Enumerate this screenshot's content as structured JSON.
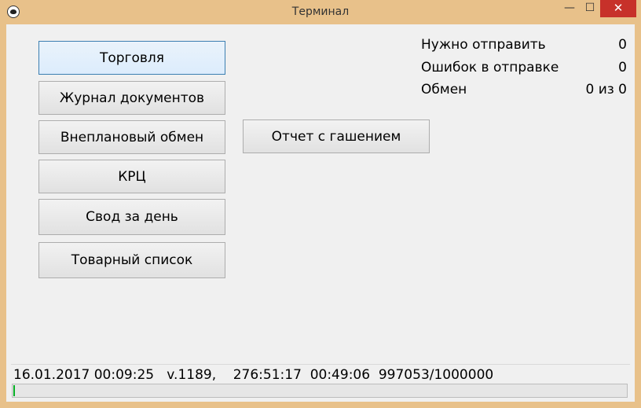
{
  "window": {
    "title": "Терминал",
    "minimize_glyph": "—",
    "maximize_glyph": "☐",
    "close_glyph": "✕",
    "close_color": "#c7312a",
    "frame_color": "#e8c18a"
  },
  "menu": {
    "trade": "Торговля",
    "journal": "Журнал документов",
    "unplanned_exchange": "Внеплановый обмен",
    "krc": "КРЦ",
    "day_summary": "Свод за день",
    "goods_list": "Товарный список",
    "z_report": "Отчет с гашением"
  },
  "stats": {
    "to_send_label": "Нужно отправить",
    "to_send_value": "0",
    "send_errors_label": "Ошибок в отправке",
    "send_errors_value": "0",
    "exchange_label": "Обмен",
    "exchange_value": "0 из 0"
  },
  "status": {
    "text": "16.01.2017 00:09:25   v.1189,    276:51:17  00:49:06  997053/1000000",
    "progress_fraction": 0.003,
    "progress_color": "#06b025"
  },
  "icons": {
    "app": "paw-icon"
  }
}
